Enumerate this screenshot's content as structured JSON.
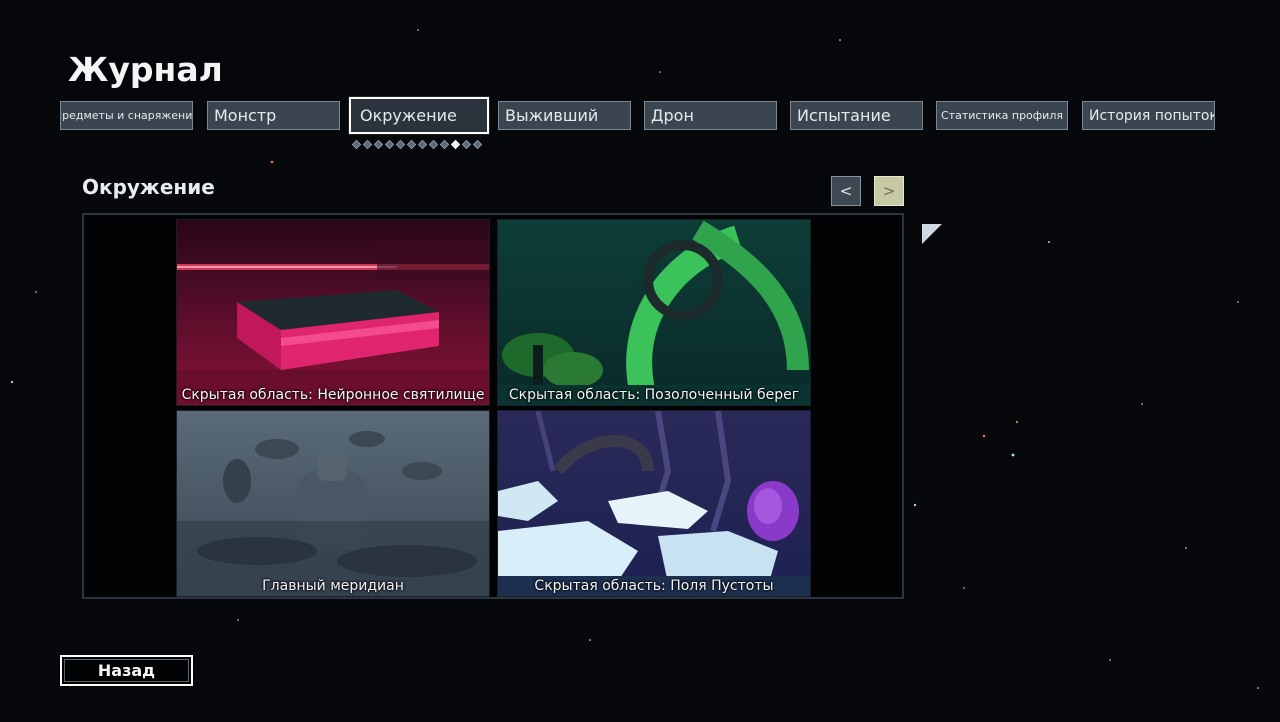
{
  "journal": {
    "title": "Журнал"
  },
  "tabs": [
    {
      "label": "Предметы и снаряжение",
      "active": false
    },
    {
      "label": "Монстр",
      "active": false
    },
    {
      "label": "Окружение",
      "active": true
    },
    {
      "label": "Выживший",
      "active": false
    },
    {
      "label": "Дрон",
      "active": false
    },
    {
      "label": "Испытание",
      "active": false
    },
    {
      "label": "Статистика профиля",
      "active": false
    },
    {
      "label": "История попыток",
      "active": false
    }
  ],
  "page_indicator": {
    "total": 12,
    "current": 10
  },
  "section": {
    "title": "Окружение",
    "prev_label": "<",
    "next_label": ">"
  },
  "environments": [
    {
      "name": "Скрытая область: Нейронное святилище",
      "scene_icon": "neural-sanctuary-scene"
    },
    {
      "name": "Скрытая область: Позолоченный берег",
      "scene_icon": "gilded-coast-scene"
    },
    {
      "name": "Главный меридиан",
      "scene_icon": "prime-meridian-scene"
    },
    {
      "name": "Скрытая область: Поля Пустоты",
      "scene_icon": "void-fields-scene"
    }
  ],
  "footer": {
    "back_label": "Назад"
  },
  "colors": {
    "background": "#06080c",
    "tab_fill": "#3a4550",
    "tab_border": "#7b8894",
    "active_border": "#ffffff",
    "next_button": "#c7c9a4"
  }
}
